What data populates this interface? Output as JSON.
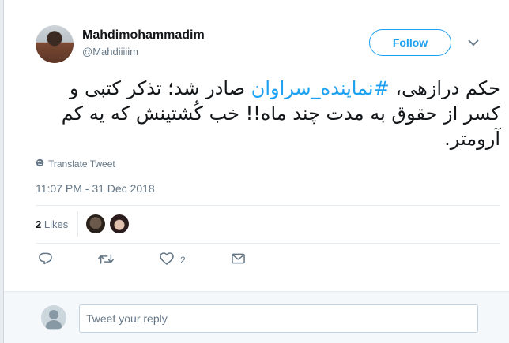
{
  "tweet": {
    "author": {
      "display_name": "Mahdimohammadim",
      "handle": "@Mahdiiiiim",
      "avatar": "author-avatar"
    },
    "follow_label": "Follow",
    "menu_icon": "chevron-down-icon",
    "text_before": "حکم درازهی، ",
    "hashtag": "#نماینده_سراوان",
    "text_after": " صادر شد؛ تذکر کتبی و کسر از حقوق به مدت چند ماه!! خب کُشتینش که یه کم آرومتر.",
    "translate_label": "Translate Tweet",
    "timestamp": "11:07 PM - 31 Dec 2018",
    "likes_count": "2",
    "likes_label": "Likes",
    "actions": {
      "reply_icon": "reply-icon",
      "retweet_icon": "retweet-icon",
      "like_icon": "heart-icon",
      "like_count": "2",
      "dm_icon": "envelope-icon"
    }
  },
  "reply": {
    "placeholder": "Tweet your reply"
  },
  "colors": {
    "accent": "#1da1f2",
    "secondary_text": "#657786",
    "background": "#e6ecf0"
  }
}
